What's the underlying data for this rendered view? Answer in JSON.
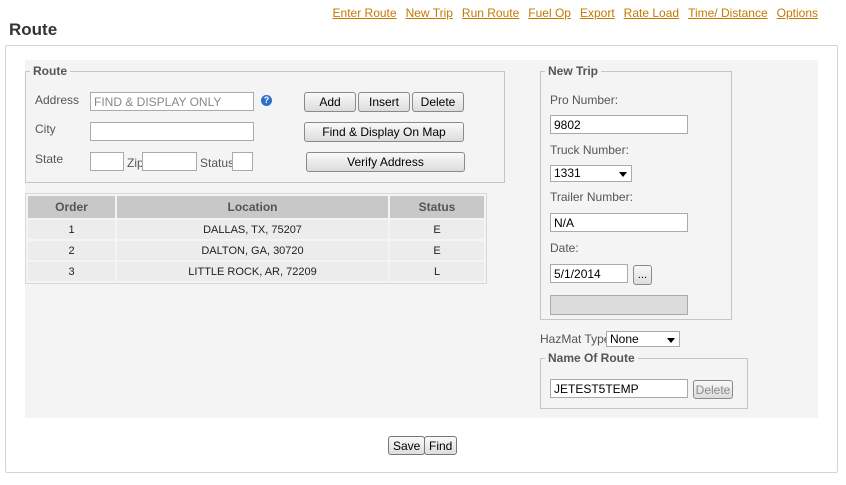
{
  "nav": {
    "links": [
      {
        "label": "Enter Route"
      },
      {
        "label": "New Trip"
      },
      {
        "label": "Run Route"
      },
      {
        "label": "Fuel Op"
      },
      {
        "label": "Export"
      },
      {
        "label": "Rate Load"
      },
      {
        "label": "Time/ Distance"
      },
      {
        "label": "Options"
      }
    ]
  },
  "page": {
    "title": "Route"
  },
  "route_form": {
    "legend": "Route",
    "address_label": "Address",
    "address_value": "FIND & DISPLAY ONLY",
    "help_glyph": "?",
    "city_label": "City",
    "city_value": "",
    "state_label": "State",
    "state_value": "",
    "zip_label": "Zip",
    "zip_value": "",
    "status_label": "Status",
    "status_value": "",
    "add_button": "Add",
    "insert_button": "Insert",
    "delete_button": "Delete",
    "find_display_button": "Find & Display On Map",
    "verify_button": "Verify Address"
  },
  "stops_table": {
    "headers": [
      "Order",
      "Location",
      "Status"
    ],
    "rows": [
      {
        "order": "1",
        "location": "DALLAS, TX, 75207",
        "status": "E"
      },
      {
        "order": "2",
        "location": "DALTON, GA, 30720",
        "status": "E"
      },
      {
        "order": "3",
        "location": "LITTLE ROCK, AR, 72209",
        "status": "L"
      }
    ]
  },
  "new_trip": {
    "legend": "New Trip",
    "pro_label": "Pro Number:",
    "pro_value": "9802",
    "truck_label": "Truck Number:",
    "truck_value": "1331",
    "trailer_label": "Trailer Number:",
    "trailer_value": "N/A",
    "date_label": "Date:",
    "date_value": "5/1/2014",
    "date_picker_label": "..."
  },
  "hazmat": {
    "label": "HazMat Type",
    "value": "None"
  },
  "name_of_route": {
    "legend": "Name Of Route",
    "value": "JETEST5TEMP",
    "delete_button": "Delete"
  },
  "footer": {
    "save_button": "Save",
    "find_button": "Find"
  }
}
